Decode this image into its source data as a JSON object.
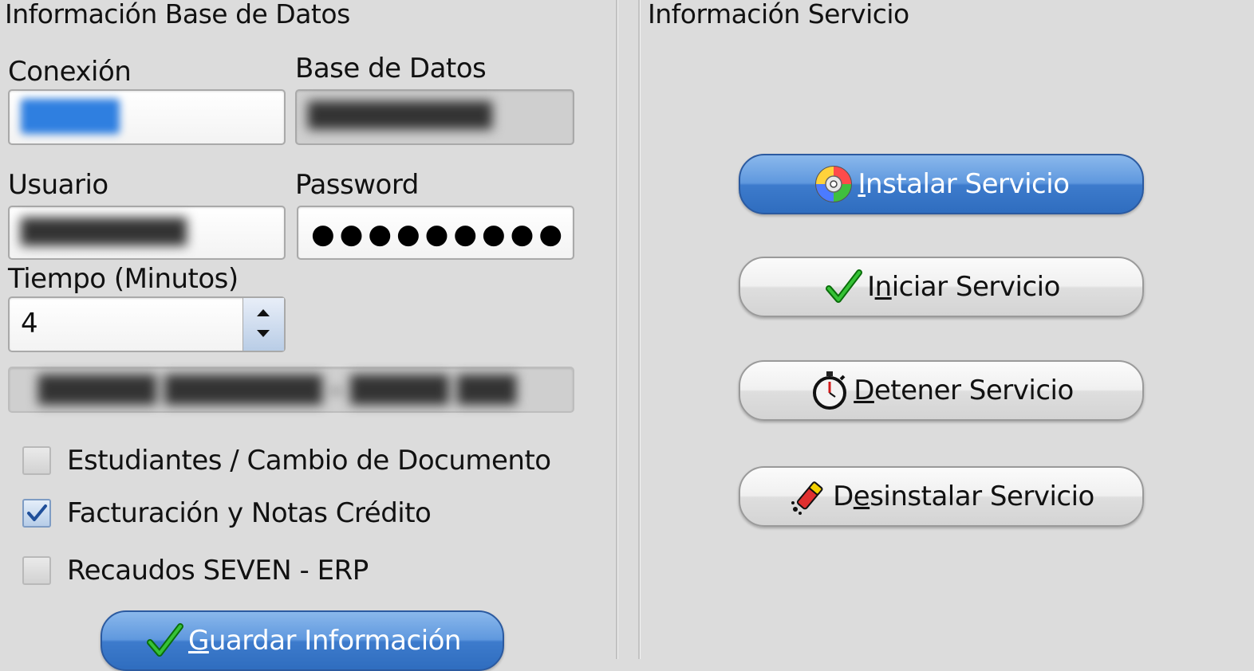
{
  "left_panel": {
    "title": "Información Base de Datos",
    "connection_label": "Conexión",
    "database_label": "Base de Datos",
    "user_label": "Usuario",
    "password_label": "Password",
    "password_value": "●●●●●●●●●",
    "time_label": "Tiempo (Minutos)",
    "time_value": "4",
    "checkboxes": [
      {
        "label": "Estudiantes / Cambio de Documento",
        "checked": false
      },
      {
        "label": "Facturación y Notas Crédito",
        "checked": true
      },
      {
        "label": "Recaudos SEVEN - ERP",
        "checked": false
      }
    ],
    "save_button": {
      "first": "G",
      "rest": "uardar Información",
      "icon": "checkmark-icon"
    }
  },
  "right_panel": {
    "title": "Información Servicio",
    "buttons": [
      {
        "first": "I",
        "rest": "nstalar Servicio",
        "icon": "cd-install-icon",
        "primary": true
      },
      {
        "first": "I",
        "rest": "niciar Servicio",
        "icon": "checkmark-icon",
        "primary": false
      },
      {
        "first": "D",
        "rest": "etener Servicio",
        "icon": "stopwatch-icon",
        "primary": false
      },
      {
        "first": "D",
        "rest": "esinstalar Servicio",
        "icon": "eraser-icon",
        "primary": false
      }
    ]
  },
  "colors": {
    "background": "#dcdcdc",
    "primary_button": "#3d7bcc",
    "check_green": "#1aa01a"
  }
}
